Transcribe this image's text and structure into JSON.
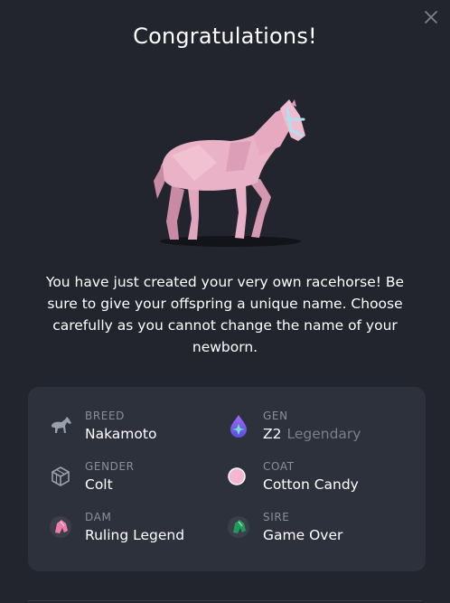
{
  "dialog": {
    "title": "Congratulations!",
    "message": "You have just created your very own racehorse! Be sure to give your offspring a unique name. Choose carefully as you cannot change the name of your newborn."
  },
  "details": {
    "breed": {
      "label": "BREED",
      "value": "Nakamoto",
      "icon": "horse-silhouette-icon"
    },
    "gen": {
      "label": "GEN",
      "value": "Z2",
      "tier": "Legendary",
      "icon": "gem-icon"
    },
    "gender": {
      "label": "GENDER",
      "value": "Colt",
      "icon": "cube-icon"
    },
    "coat": {
      "label": "COAT",
      "value": "Cotton Candy",
      "color": "#f7b6cf",
      "icon": "coat-color-dot"
    },
    "dam": {
      "label": "DAM",
      "value": "Ruling Legend",
      "icon": "dam-horse-head-icon"
    },
    "sire": {
      "label": "SIRE",
      "value": "Game Over",
      "icon": "sire-horse-head-icon"
    }
  },
  "colors": {
    "background": "#22252d",
    "card": "#2d313b",
    "coat": "#f7b6cf"
  }
}
